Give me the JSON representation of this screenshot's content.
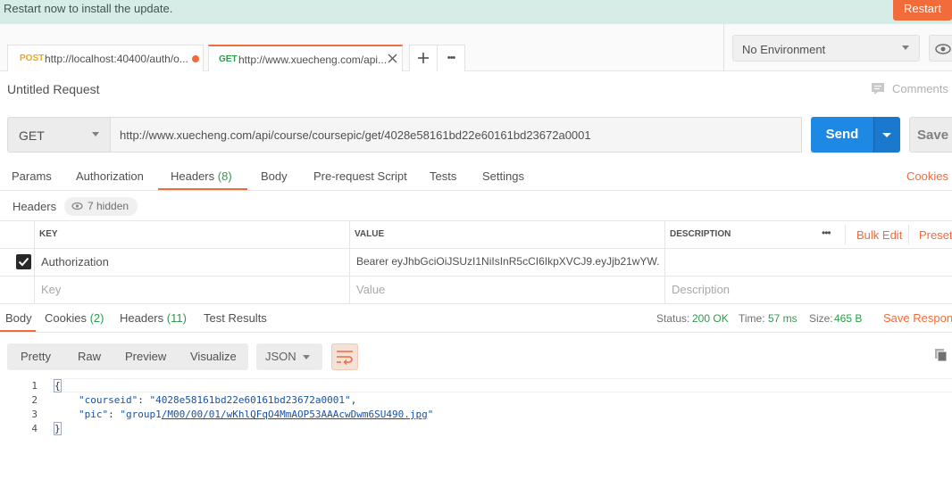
{
  "banner": {
    "text": "Restart now to install the update.",
    "restart_label": "Restart"
  },
  "tabs": [
    {
      "method": "POST",
      "url": "http://localhost:40400/auth/o...",
      "method_color": "#f0a61a",
      "unsaved": true
    },
    {
      "method": "GET",
      "url": "http://www.xuecheng.com/api...",
      "method_color": "#2a9d4a",
      "active": true
    }
  ],
  "tab_actions": {
    "new": "+",
    "more": "•••"
  },
  "environment": {
    "selected": "No Environment"
  },
  "request": {
    "title": "Untitled Request",
    "comments_label": "Comments",
    "method": "GET",
    "url": "http://www.xuecheng.com/api/course/coursepic/get/4028e58161bd22e60161bd23672a0001",
    "send_label": "Send",
    "save_label": "Save"
  },
  "request_tabs": {
    "params": "Params",
    "authorization": "Authorization",
    "headers": "Headers",
    "headers_count": "(8)",
    "body": "Body",
    "prerequest": "Pre-request Script",
    "tests": "Tests",
    "settings": "Settings",
    "cookies": "Cookies"
  },
  "headers_section": {
    "label": "Headers",
    "hidden": "7 hidden"
  },
  "headers_table": {
    "columns": {
      "key": "KEY",
      "value": "VALUE",
      "description": "DESCRIPTION"
    },
    "more": "•••",
    "bulk_edit": "Bulk Edit",
    "presets": "Presets",
    "rows": [
      {
        "key": "Authorization",
        "value": "Bearer eyJhbGciOiJSUzI1NiIsInR5cCI6IkpXVCJ9.eyJjb21wYW...",
        "description": "",
        "checked": true
      }
    ],
    "placeholders": {
      "key": "Key",
      "value": "Value",
      "description": "Description"
    }
  },
  "response_tabs": {
    "body": "Body",
    "cookies": "Cookies",
    "cookies_count": "(2)",
    "headers": "Headers",
    "headers_count": "(11)",
    "test_results": "Test Results"
  },
  "response_status": {
    "status_label": "Status:",
    "status": "200 OK",
    "time_label": "Time:",
    "time": "57 ms",
    "size_label": "Size:",
    "size": "465 B",
    "save_response": "Save Respons"
  },
  "response_view": {
    "pretty": "Pretty",
    "raw": "Raw",
    "preview": "Preview",
    "visualize": "Visualize",
    "format": "JSON"
  },
  "response_body": {
    "line_numbers": [
      "1",
      "2",
      "3",
      "4"
    ],
    "open_brace": "{",
    "close_brace": "}",
    "courseid_key": "\"courseid\"",
    "courseid_value": "\"4028e58161bd22e60161bd23672a0001\"",
    "pic_key": "\"pic\"",
    "pic_value_prefix": "\"group1",
    "pic_value_link": "/M00/00/01/wKhlQFqO4MmAOP53AAAcwDwm6SU490.jpg",
    "pic_value_suffix": "\""
  },
  "colors": {
    "accent": "#f26b3a",
    "send": "#1e88e5",
    "success": "#2a9d4a",
    "banner_bg": "#d5ede6"
  }
}
